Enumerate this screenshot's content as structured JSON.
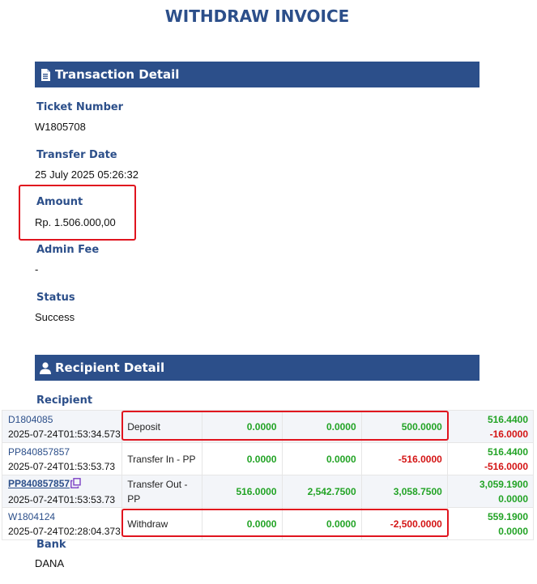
{
  "page": {
    "title": "WITHDRAW INVOICE"
  },
  "transaction_detail": {
    "header": "Transaction Detail",
    "icon": "document-icon",
    "fields": {
      "ticket_number": {
        "label": "Ticket Number",
        "value": "W1805708"
      },
      "transfer_date": {
        "label": "Transfer Date",
        "value": "25 July 2025 05:26:32"
      },
      "amount": {
        "label": "Amount",
        "value": "Rp. 1.506.000,00"
      },
      "admin_fee": {
        "label": "Admin Fee",
        "value": "-"
      },
      "status": {
        "label": "Status",
        "value": "Success"
      }
    }
  },
  "recipient_detail": {
    "header": "Recipient Detail",
    "icon": "user-icon",
    "recipient_label": "Recipient",
    "bank_label": "Bank",
    "bank_value": "DANA"
  },
  "transactions": [
    {
      "id": "D1804085",
      "time": "2025-07-24T01:53:34.573",
      "type": "Deposit",
      "col1": "0.0000",
      "col2": "0.0000",
      "col3": "500.0000",
      "bal1": "516.4400",
      "bal2": "-16.0000"
    },
    {
      "id": "PP840857857",
      "time": "2025-07-24T01:53:53.73",
      "type": "Transfer In - PP",
      "col1": "0.0000",
      "col2": "0.0000",
      "col3": "-516.0000",
      "bal1": "516.4400",
      "bal2": "-516.0000"
    },
    {
      "id": "PP840857857",
      "time": "2025-07-24T01:53:53.73",
      "type": "Transfer Out - PP",
      "col1": "516.0000",
      "col2": "2,542.7500",
      "col3": "3,058.7500",
      "bal1": "3,059.1900",
      "bal2": "0.0000"
    },
    {
      "id": "W1804124",
      "time": "2025-07-24T02:28:04.373",
      "type": "Withdraw",
      "col1": "0.0000",
      "col2": "0.0000",
      "col3": "-2,500.0000",
      "bal1": "559.1900",
      "bal2": "0.0000"
    }
  ],
  "colors": {
    "brand": "#2c4f8a",
    "positive": "#22a325",
    "negative": "#d41414",
    "highlight": "#e0141e"
  }
}
